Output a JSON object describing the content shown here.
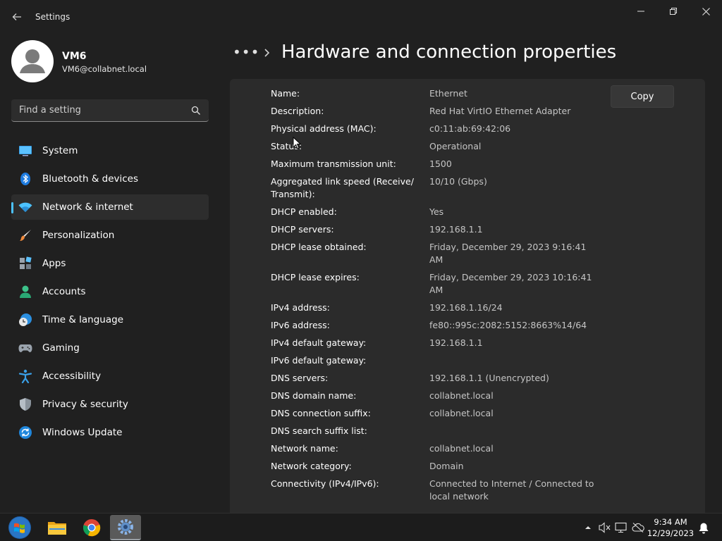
{
  "window": {
    "app_title": "Settings"
  },
  "user": {
    "name": "VM6",
    "email": "VM6@collabnet.local"
  },
  "search": {
    "placeholder": "Find a setting"
  },
  "nav": {
    "items": [
      {
        "label": "System",
        "icon": "system-icon"
      },
      {
        "label": "Bluetooth & devices",
        "icon": "bluetooth-icon"
      },
      {
        "label": "Network & internet",
        "icon": "wifi-icon",
        "active": true
      },
      {
        "label": "Personalization",
        "icon": "brush-icon"
      },
      {
        "label": "Apps",
        "icon": "apps-icon"
      },
      {
        "label": "Accounts",
        "icon": "account-icon"
      },
      {
        "label": "Time & language",
        "icon": "clock-globe-icon"
      },
      {
        "label": "Gaming",
        "icon": "gamepad-icon"
      },
      {
        "label": "Accessibility",
        "icon": "accessibility-icon"
      },
      {
        "label": "Privacy & security",
        "icon": "shield-icon"
      },
      {
        "label": "Windows Update",
        "icon": "update-icon"
      }
    ]
  },
  "header": {
    "breadcrumb_more": "•••",
    "title": "Hardware and connection properties"
  },
  "copy_label": "Copy",
  "properties": [
    {
      "key": "Name:",
      "value": "Ethernet"
    },
    {
      "key": "Description:",
      "value": "Red Hat VirtIO Ethernet Adapter"
    },
    {
      "key": "Physical address (MAC):",
      "value": "c0:11:ab:69:42:06"
    },
    {
      "key": "Status:",
      "value": "Operational"
    },
    {
      "key": "Maximum transmission unit:",
      "value": "1500"
    },
    {
      "key": "Aggregated link speed (Receive/ Transmit):",
      "value": "10/10 (Gbps)"
    },
    {
      "key": "DHCP enabled:",
      "value": "Yes"
    },
    {
      "key": "DHCP servers:",
      "value": "192.168.1.1"
    },
    {
      "key": "DHCP lease obtained:",
      "value": "Friday, December 29, 2023 9:16:41 AM"
    },
    {
      "key": "DHCP lease expires:",
      "value": "Friday, December 29, 2023 10:16:41 AM"
    },
    {
      "key": "IPv4 address:",
      "value": "192.168.1.16/24"
    },
    {
      "key": "IPv6 address:",
      "value": "fe80::995c:2082:5152:8663%14/64"
    },
    {
      "key": "IPv4 default gateway:",
      "value": "192.168.1.1"
    },
    {
      "key": "IPv6 default gateway:",
      "value": ""
    },
    {
      "key": "DNS servers:",
      "value": "192.168.1.1 (Unencrypted)"
    },
    {
      "key": "DNS domain name:",
      "value": "collabnet.local"
    },
    {
      "key": "DNS connection suffix:",
      "value": "collabnet.local"
    },
    {
      "key": "DNS search suffix list:",
      "value": ""
    },
    {
      "key": "Network name:",
      "value": "collabnet.local"
    },
    {
      "key": "Network category:",
      "value": "Domain"
    },
    {
      "key": "Connectivity (IPv4/IPv6):",
      "value": "Connected to Internet / Connected to local network"
    }
  ],
  "taskbar": {
    "clock_time": "9:34 AM",
    "clock_date": "12/29/2023",
    "apps": [
      "start-icon",
      "file-explorer-icon",
      "chrome-icon",
      "settings-icon"
    ]
  },
  "colors": {
    "accent": "#4cc2ff",
    "window_bg": "#202020",
    "panel_bg": "#2b2b2b"
  }
}
